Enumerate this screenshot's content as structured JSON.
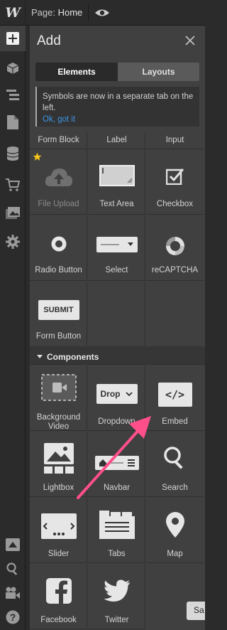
{
  "topbar": {
    "logo": "W",
    "page_prefix": "Page:",
    "page_name": "Home"
  },
  "leftnav": {
    "items": [
      {
        "icon": "plus-icon"
      },
      {
        "icon": "box-icon"
      },
      {
        "icon": "navigator-icon"
      },
      {
        "icon": "pages-icon"
      },
      {
        "icon": "database-icon"
      },
      {
        "icon": "cart-icon"
      },
      {
        "icon": "assets-icon"
      },
      {
        "icon": "settings-icon"
      }
    ],
    "bottom_items": [
      {
        "icon": "audit-icon"
      },
      {
        "icon": "search-icon"
      },
      {
        "icon": "video-icon"
      },
      {
        "icon": "help-icon"
      }
    ]
  },
  "panel": {
    "title": "Add",
    "tabs": [
      "Elements",
      "Layouts"
    ],
    "notice_text": "Symbols are now in a separate tab on the left.",
    "notice_link": "Ok, got it"
  },
  "forms": {
    "partial_labels": [
      "Form Block",
      "Label",
      "Input"
    ],
    "items": [
      {
        "label": "File Upload",
        "icon": "cloud-upload-icon"
      },
      {
        "label": "Text Area",
        "icon": "textarea-icon"
      },
      {
        "label": "Checkbox",
        "icon": "checkbox-icon"
      },
      {
        "label": "Radio Button",
        "icon": "radio-icon"
      },
      {
        "label": "Select",
        "icon": "select-icon"
      },
      {
        "label": "reCAPTCHA",
        "icon": "recaptcha-icon"
      },
      {
        "label": "Form Button",
        "icon": "submit-icon",
        "button_text": "SUBMIT"
      }
    ]
  },
  "components": {
    "heading": "Components",
    "items": [
      {
        "label_line1": "Background",
        "label_line2": "Video",
        "icon": "background-video-icon"
      },
      {
        "label": "Dropdown",
        "icon": "dropdown-icon",
        "icon_text": "Drop"
      },
      {
        "label": "Embed",
        "icon": "embed-icon",
        "icon_text": "</>"
      },
      {
        "label": "Lightbox",
        "icon": "lightbox-icon"
      },
      {
        "label": "Navbar",
        "icon": "navbar-icon"
      },
      {
        "label": "Search",
        "icon": "search-icon"
      },
      {
        "label": "Slider",
        "icon": "slider-icon"
      },
      {
        "label": "Tabs",
        "icon": "tabs-icon"
      },
      {
        "label": "Map",
        "icon": "map-pin-icon"
      },
      {
        "label": "Facebook",
        "icon": "facebook-icon"
      },
      {
        "label": "Twitter",
        "icon": "twitter-icon"
      }
    ]
  },
  "save_button": "Sa",
  "colors": {
    "accent_arrow": "#ff4f8b",
    "link": "#3d97e8",
    "star": "#f5c518"
  }
}
